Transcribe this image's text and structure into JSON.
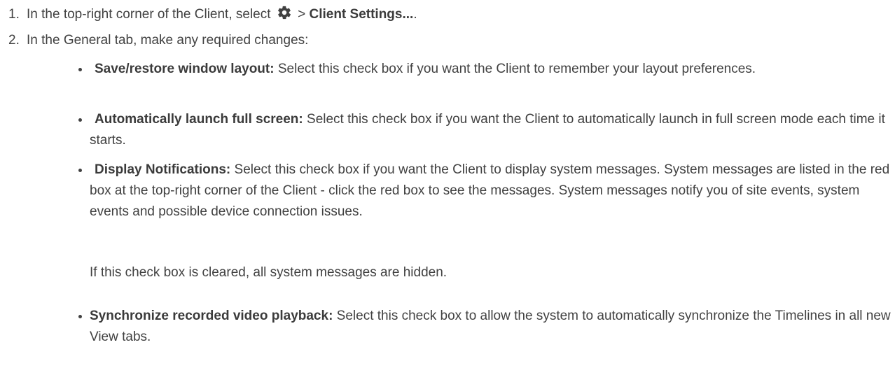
{
  "steps": [
    {
      "number": "1.",
      "text_before": "In the top-right corner of the Client, select",
      "icon": "gear-icon",
      "separator": ">",
      "bold": "Client Settings...",
      "text_after": "."
    },
    {
      "number": "2.",
      "text": "In the General tab, make any required changes:"
    }
  ],
  "bullets": [
    {
      "term": "Save/restore window layout:",
      "description": "Select this check box if you want the Client to remember your layout preferences."
    },
    {
      "term": "Automatically launch full screen:",
      "description": "Select this check box if you want the Client to automatically launch in full screen mode each time it starts."
    },
    {
      "term": "Display Notifications:",
      "description": "Select this check box if you want the Client to display system messages. System messages are listed in the red box at the top-right corner of the Client - click the red box to see the messages. System messages notify you of site events, system events and possible device connection issues."
    },
    {
      "term": "Synchronize recorded video playback:",
      "description": "Select this check box to allow the system to automatically synchronize the Timelines in all new View tabs."
    }
  ],
  "note": "If this check box is cleared, all system messages are hidden.",
  "colors": {
    "text": "#414141",
    "icon": "#414141"
  }
}
